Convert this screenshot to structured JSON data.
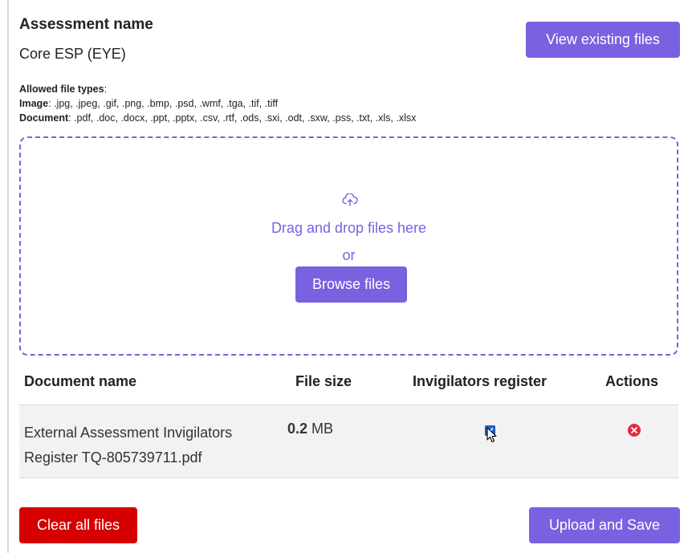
{
  "assessment": {
    "label": "Assessment name",
    "value": "Core ESP (EYE)"
  },
  "view_button": "View existing files",
  "file_types": {
    "heading": "Allowed file types",
    "image_label": "Image",
    "image_list": ": .jpg, .jpeg, .gif, .png, .bmp, .psd, .wmf, .tga, .tif, .tiff",
    "document_label": "Document",
    "document_list": ": .pdf, .doc, .docx, .ppt, .pptx, .csv, .rtf, .ods, .sxi, .odt, .sxw, .pss, .txt, .xls, .xlsx"
  },
  "dropzone": {
    "icon": "cloud-upload-icon",
    "main_text": "Drag and drop files here",
    "or_text": "or",
    "browse_button": "Browse files"
  },
  "table": {
    "headers": {
      "name": "Document name",
      "size": "File size",
      "register": "Invigilators register",
      "actions": "Actions"
    },
    "rows": [
      {
        "name": "External Assessment Invigilators Register TQ-805739711.pdf",
        "size_value": "0.2",
        "size_unit": " MB",
        "register_checked": true,
        "action_icon": "remove-icon"
      }
    ]
  },
  "footer": {
    "clear_button": "Clear all files",
    "upload_button": "Upload and Save"
  },
  "colors": {
    "accent": "#7a61e0",
    "danger": "#d60000",
    "row_bg": "#f2f2f2",
    "checkbox": "#1a66d6",
    "remove_icon": "#e02b3c"
  }
}
